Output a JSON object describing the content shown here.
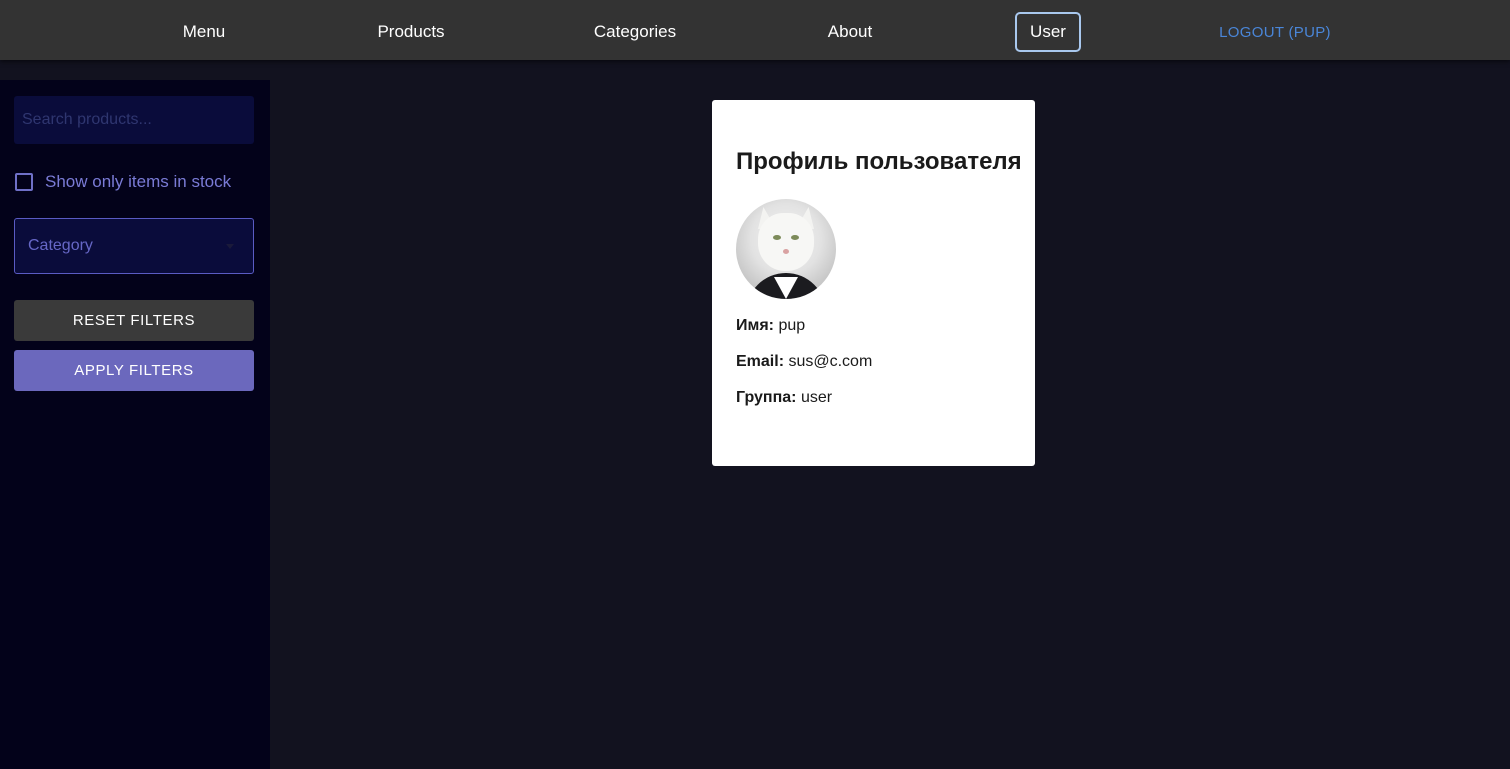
{
  "nav": {
    "items": [
      {
        "label": "Menu"
      },
      {
        "label": "Products"
      },
      {
        "label": "Categories"
      },
      {
        "label": "About"
      },
      {
        "label": "User",
        "active": true
      },
      {
        "label": "LOGOUT (PUP)"
      }
    ]
  },
  "sidebar": {
    "search_placeholder": "Search products...",
    "stock_label": "Show only items in stock",
    "stock_checked": false,
    "category_label": "Category",
    "reset_label": "RESET FILTERS",
    "apply_label": "APPLY FILTERS"
  },
  "profile": {
    "title": "Профиль пользователя",
    "avatar": "cat-in-suit-avatar",
    "name_label": "Имя:",
    "name_value": "pup",
    "email_label": "Email:",
    "email_value": "sus@c.com",
    "group_label": "Группа:",
    "group_value": "user"
  },
  "colors": {
    "topbar": "#333333",
    "sidebar": "#03021a",
    "main_bg": "#12121f",
    "accent": "#6b68bd",
    "logout": "#4a86d8"
  }
}
